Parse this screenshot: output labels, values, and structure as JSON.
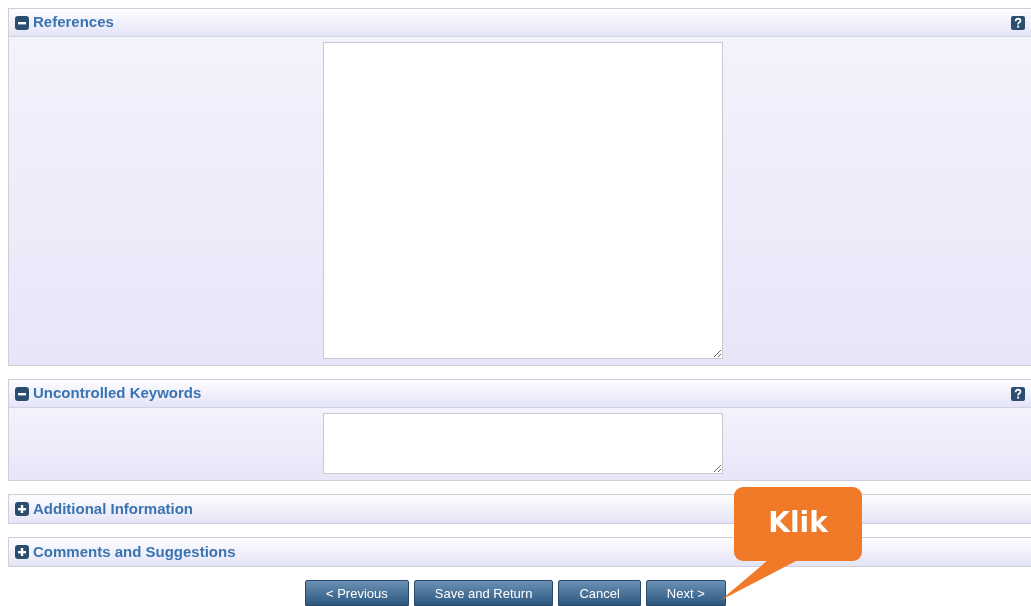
{
  "sections": [
    {
      "title": "References",
      "expanded": true,
      "help": true
    },
    {
      "title": "Uncontrolled Keywords",
      "expanded": true,
      "help": true
    },
    {
      "title": "Additional Information",
      "expanded": false,
      "help": false
    },
    {
      "title": "Comments and Suggestions",
      "expanded": false,
      "help": false
    }
  ],
  "buttons": [
    "< Previous",
    "Save and Return",
    "Cancel",
    "Next >"
  ],
  "callout": {
    "text": "Klik"
  }
}
